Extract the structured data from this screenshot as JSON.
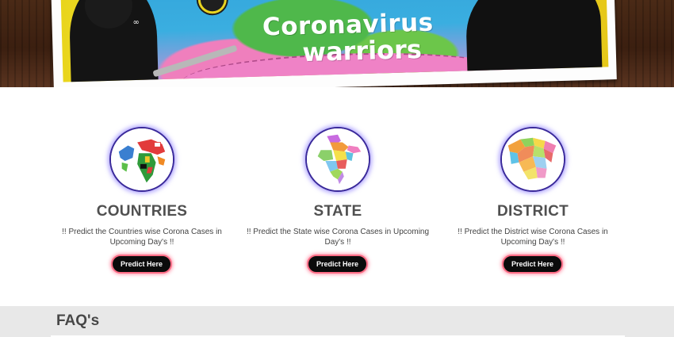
{
  "hero": {
    "title_line1": "Coronavirus",
    "title_line2": "warriors",
    "helmet_mark": "∞"
  },
  "cards": [
    {
      "title": "COUNTRIES",
      "description": "!! Predict the Countries wise Corona Cases in Upcoming Day's !!",
      "button_label": "Predict Here",
      "image": "world-map"
    },
    {
      "title": "STATE",
      "description": "!! Predict the State wise Corona Cases in Upcoming Day's !!",
      "button_label": "Predict Here",
      "image": "india-state-map"
    },
    {
      "title": "DISTRICT",
      "description": "!! Predict the District wise Corona Cases in Upcoming Day's !!",
      "button_label": "Predict Here",
      "image": "district-map"
    }
  ],
  "faq": {
    "title": "FAQ's"
  },
  "colors": {
    "button_bg": "#0b0b0b",
    "button_glow": "#ff6d86",
    "circle_border": "#3a2a9a",
    "faq_bg": "#e8e8e8",
    "title_text": "#505050"
  }
}
